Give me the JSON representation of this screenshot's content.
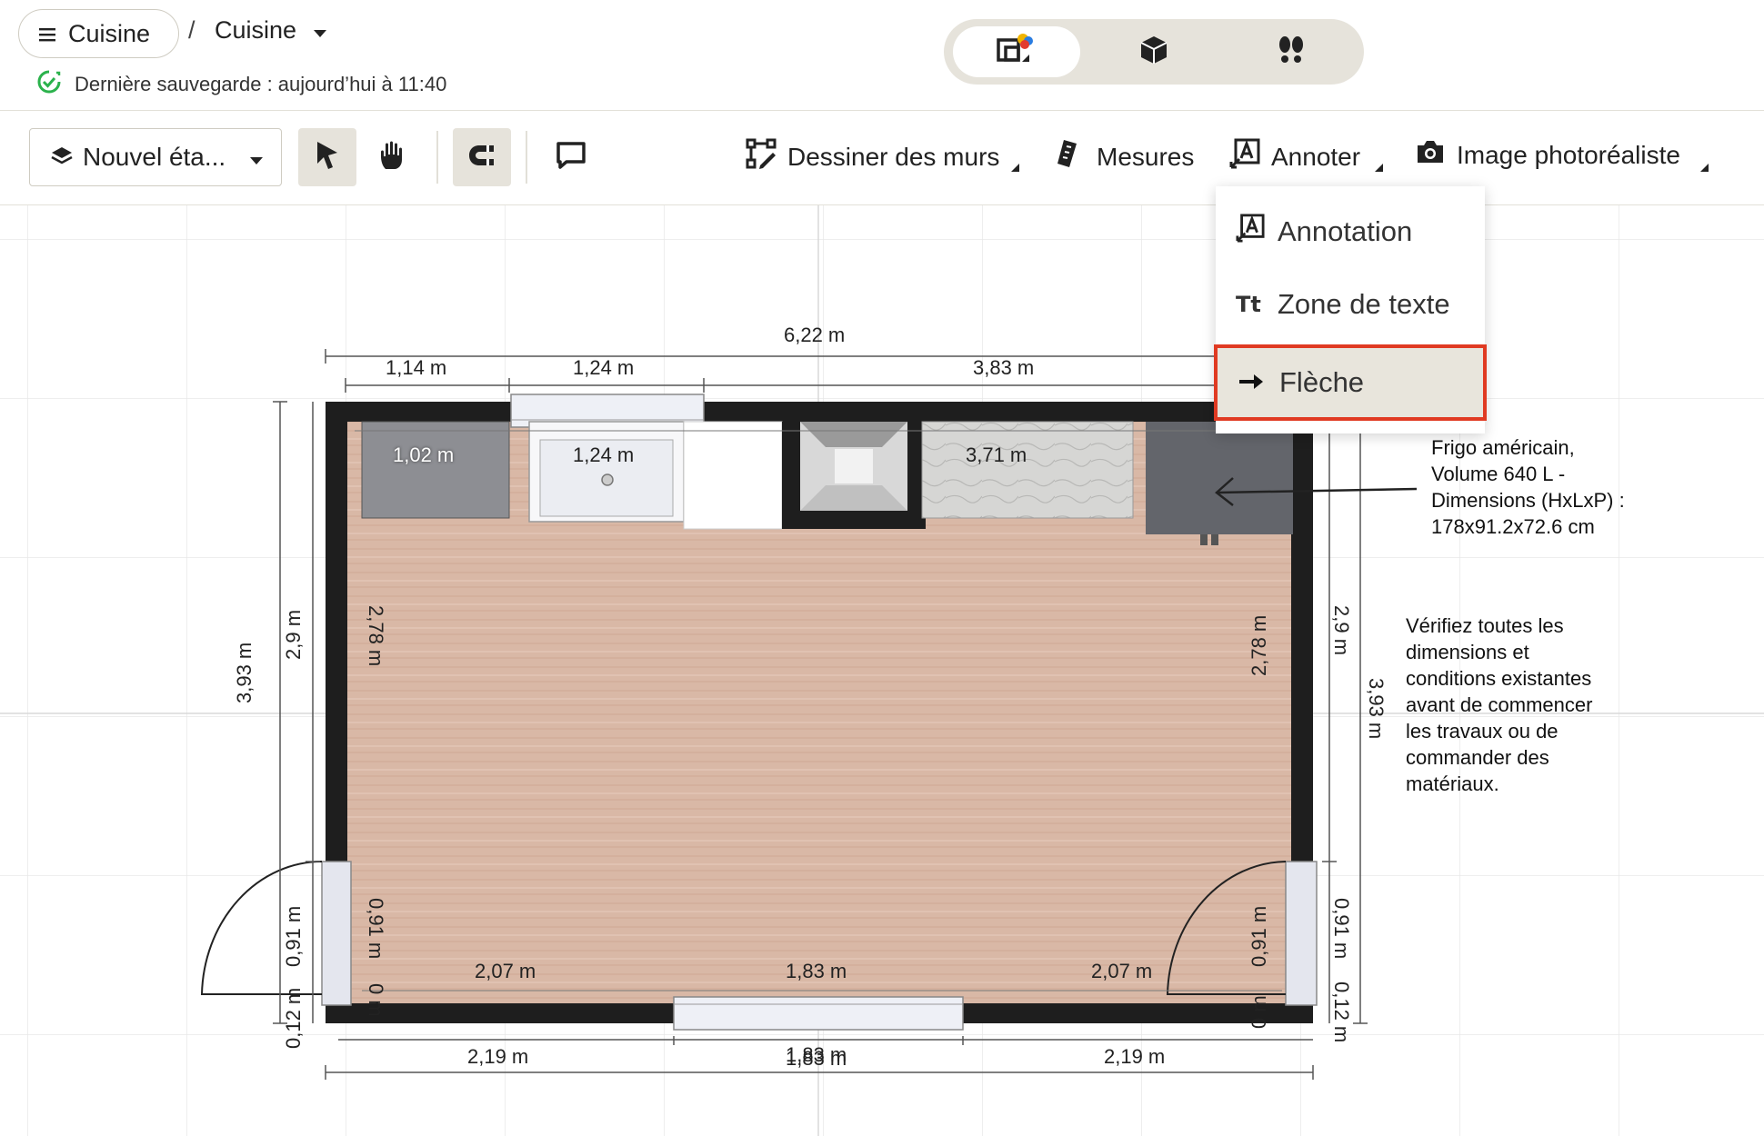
{
  "header": {
    "breadcrumb_project": "Cuisine",
    "breadcrumb_separator": "/",
    "breadcrumb_current": "Cuisine",
    "save_status": "Dernière sauvegarde : aujourd’hui à 11:40"
  },
  "toolbar": {
    "level_label": "Nouvel éta...",
    "draw_walls": "Dessiner des murs",
    "measures": "Mesures",
    "annotate": "Annoter",
    "photo_image": "Image photoréaliste"
  },
  "annotate_menu": {
    "items": [
      "Annotation",
      "Zone de texte",
      "Flèche"
    ],
    "selected": "Flèche"
  },
  "plan": {
    "dims_top": [
      "6,22 m",
      "1,14 m",
      "1,24 m",
      "3,83 m"
    ],
    "counter_labels": [
      "1,02 m",
      "1,24 m",
      "3,71 m"
    ],
    "dims_bottom": [
      "2,19 m",
      "1,83 m",
      "2,19 m"
    ],
    "dims_inner_bottom": [
      "2,07 m",
      "1,83 m",
      "2,07 m"
    ],
    "left_outer": "3,93 m",
    "left_mid": "2,9 m",
    "left_inner": "2,78 m",
    "left_door": "0,91 m",
    "left_small": "0,12 m",
    "left_zero": "0 m",
    "right_outer": "3,93 m",
    "right_mid": "2,9 m",
    "right_inner": "2,78 m",
    "right_door_outer": "0,91 m",
    "right_door_inner": "0,91 m",
    "right_small": "0,12 m",
    "right_zero": "0 m",
    "overlap_label": "1,83 m",
    "fridge_note": [
      "Frigo américain,",
      "Volume 640 L -",
      "Dimensions (HxLxP) :",
      "178x91.2x72.6 cm"
    ],
    "check_note": [
      "Vérifiez toutes les",
      "dimensions et",
      "conditions existantes",
      "avant de commencer",
      "les travaux ou de",
      "commander des",
      "matériaux."
    ]
  },
  "colors": {
    "accent_highlight": "#e03a22",
    "floor": "#d8b6a4",
    "wall": "#1e1e1e",
    "save_ok": "#2bb24c"
  }
}
